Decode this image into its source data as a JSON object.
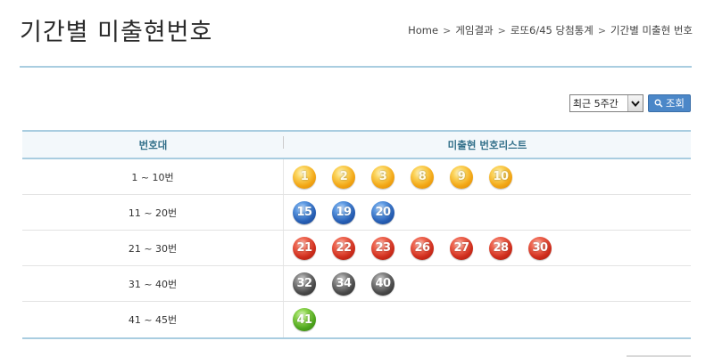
{
  "page": {
    "title": "기간별 미출현번호"
  },
  "breadcrumb": [
    "Home",
    "게임결과",
    "로또6/45 당첨통계",
    "기간별 미출현 번호"
  ],
  "controls": {
    "period_select": "최근 5주간",
    "search_label": "조회"
  },
  "table": {
    "headers": [
      "번호대",
      "미출현 번호리스트"
    ],
    "rows": [
      {
        "range": "1 ~ 10번",
        "color": "yellow",
        "numbers": [
          "1",
          "2",
          "3",
          "8",
          "9",
          "10"
        ]
      },
      {
        "range": "11 ~ 20번",
        "color": "blue",
        "numbers": [
          "15",
          "19",
          "20"
        ]
      },
      {
        "range": "21 ~ 30번",
        "color": "red",
        "numbers": [
          "21",
          "22",
          "23",
          "26",
          "27",
          "28",
          "30"
        ]
      },
      {
        "range": "31 ~ 40번",
        "color": "gray",
        "numbers": [
          "32",
          "34",
          "40"
        ]
      },
      {
        "range": "41 ~ 45번",
        "color": "green",
        "numbers": [
          "41"
        ]
      }
    ]
  },
  "icons": {
    "select_arrow": "chevron-down-icon",
    "search": "magnifier-icon"
  }
}
